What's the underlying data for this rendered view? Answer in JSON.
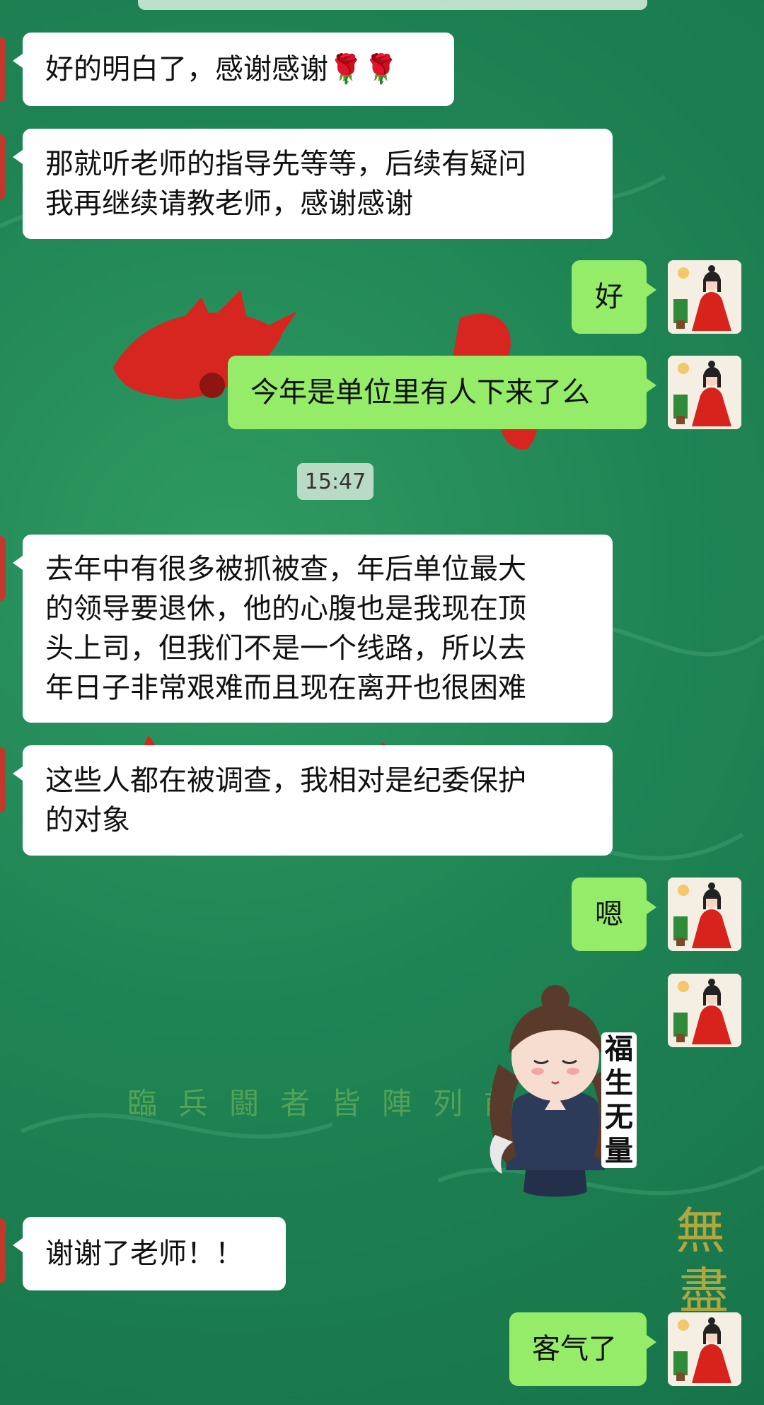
{
  "messages": [
    {
      "side": "left",
      "text": "好的明白了，感谢感谢",
      "emoji": "🌹🌹"
    },
    {
      "side": "left",
      "text": "那就听老师的指导先等等，后续有疑问\n我再继续请教老师，感谢感谢"
    },
    {
      "side": "right",
      "text": "好"
    },
    {
      "side": "right",
      "text": "今年是单位里有人下来了么"
    },
    {
      "side": "left",
      "text": "去年中有很多被抓被查，年后单位最大\n的领导要退休，他的心腹也是我现在顶\n头上司，但我们不是一个线路，所以去\n年日子非常艰难而且现在离开也很困难"
    },
    {
      "side": "left",
      "text": "这些人都在被调查，我相对是纪委保护\n的对象"
    },
    {
      "side": "right",
      "text": "嗯"
    },
    {
      "side": "left",
      "text": "谢谢了老师！！"
    },
    {
      "side": "right",
      "text": "客气了"
    }
  ],
  "timestamp": "15:47",
  "sticker": {
    "text": "福\n生\n无\n量",
    "icon": "praying-girl-sticker"
  },
  "colors": {
    "right_bubble": "#95ec69",
    "left_bubble": "#ffffff",
    "background": "#1f8454"
  }
}
